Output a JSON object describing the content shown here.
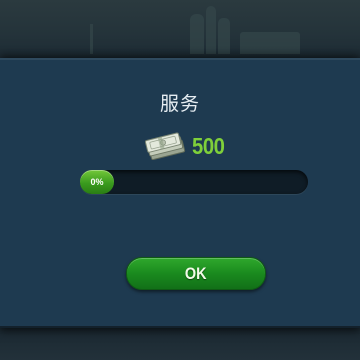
{
  "dialog": {
    "title": "服务",
    "reward": {
      "icon": "cash-stack-icon",
      "amount": "500",
      "color": "#7fd03a"
    },
    "progress": {
      "label": "0%",
      "value": 0
    },
    "ok_label": "OK",
    "accent_green": "#1a8a1e"
  }
}
